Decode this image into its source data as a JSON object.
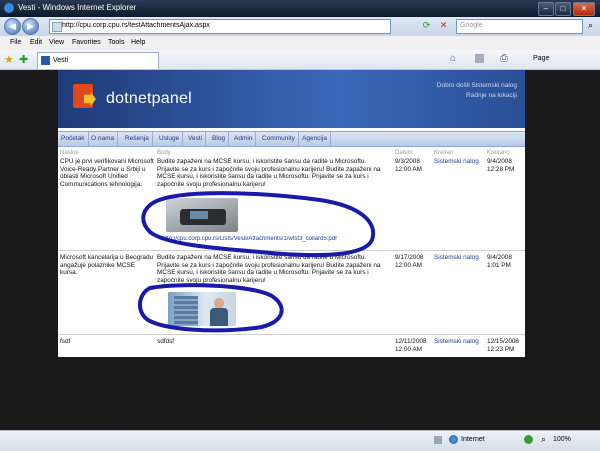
{
  "window": {
    "title": "Vesti - Windows Internet Explorer"
  },
  "address": {
    "url": "http://cpu.corp.cpu.rs/testAttachmentsAjax.aspx",
    "search_placeholder": "Google"
  },
  "menu": [
    "File",
    "Edit",
    "View",
    "Favorites",
    "Tools",
    "Help"
  ],
  "tab": {
    "label": "Vesti"
  },
  "toolbar": {
    "page_label": "Page"
  },
  "site": {
    "brand": "dotnetpanel",
    "welcome": "Dobro došli Sistemski nalog",
    "settings": "Radnje na lokaciji",
    "nav": [
      "Početak",
      "O nama",
      "Rešenja",
      "Usluge",
      "Vesti",
      "Blog",
      "Admin",
      "Community",
      "Agencija"
    ]
  },
  "table": {
    "headers": [
      "Naslov",
      "Body",
      "Datum",
      "Kreirao",
      "Kreirano"
    ],
    "rows": [
      {
        "title": "CPU je prvi verifikovani Microsoft Voice-Ready Partner u Srbiji u oblasti Microsoft Unified Communications tehnologija.",
        "body": "Budite zapaženi na MCSE kursu, i iskoristite šansu da radite u Microsoftu. Prijavite se za kurs i započnite svoju profesionalnu karijeru! Budite zapaženi na MCSE kursu, i iskoristite šansu da radite u Microsoftu. Prijavite se za kurs i započnite svoju profesionalnu karijeru!",
        "date": "9/3/2008",
        "time": "12:00 AM",
        "author": "Sistemski nalog",
        "created_date": "9/4/2008",
        "created_time": "12:28 PM",
        "attachment": "http://cpu.corp.cpu.rs/Lists/Vesti/Attachments/1/wtst3_collard5.pdf"
      },
      {
        "title": "Microsoft kancelarija u Beogradu angažuje polaznike MCSE kursa.",
        "body": "Budite zapaženi na MCSE kursu, i iskoristite šansu da radite u Microsoftu. Prijavite se za kurs i započnite svoju profesionalnu karijeru! Budite zapaženi na MCSE kursu, i iskoristite šansu da radite u Microsoftu. Prijavite se za kurs i započnite svoju profesionalnu karijeru!",
        "date": "9/17/2008",
        "time": "12:00 AM",
        "author": "Sistemski nalog",
        "created_date": "9/4/2008",
        "created_time": "1:01 PM"
      },
      {
        "title": "fsdf",
        "body": "sdfdsf",
        "date": "12/11/2008",
        "time": "12:00 AM",
        "author": "Sistemski nalog",
        "created_date": "12/15/2008",
        "created_time": "12:23 PM"
      }
    ]
  },
  "status": {
    "zone": "Internet",
    "zoom": "100%"
  },
  "colors": {
    "annotation": "#1a1aa8",
    "link": "#1c3d9a",
    "header": "#2a4f96"
  }
}
